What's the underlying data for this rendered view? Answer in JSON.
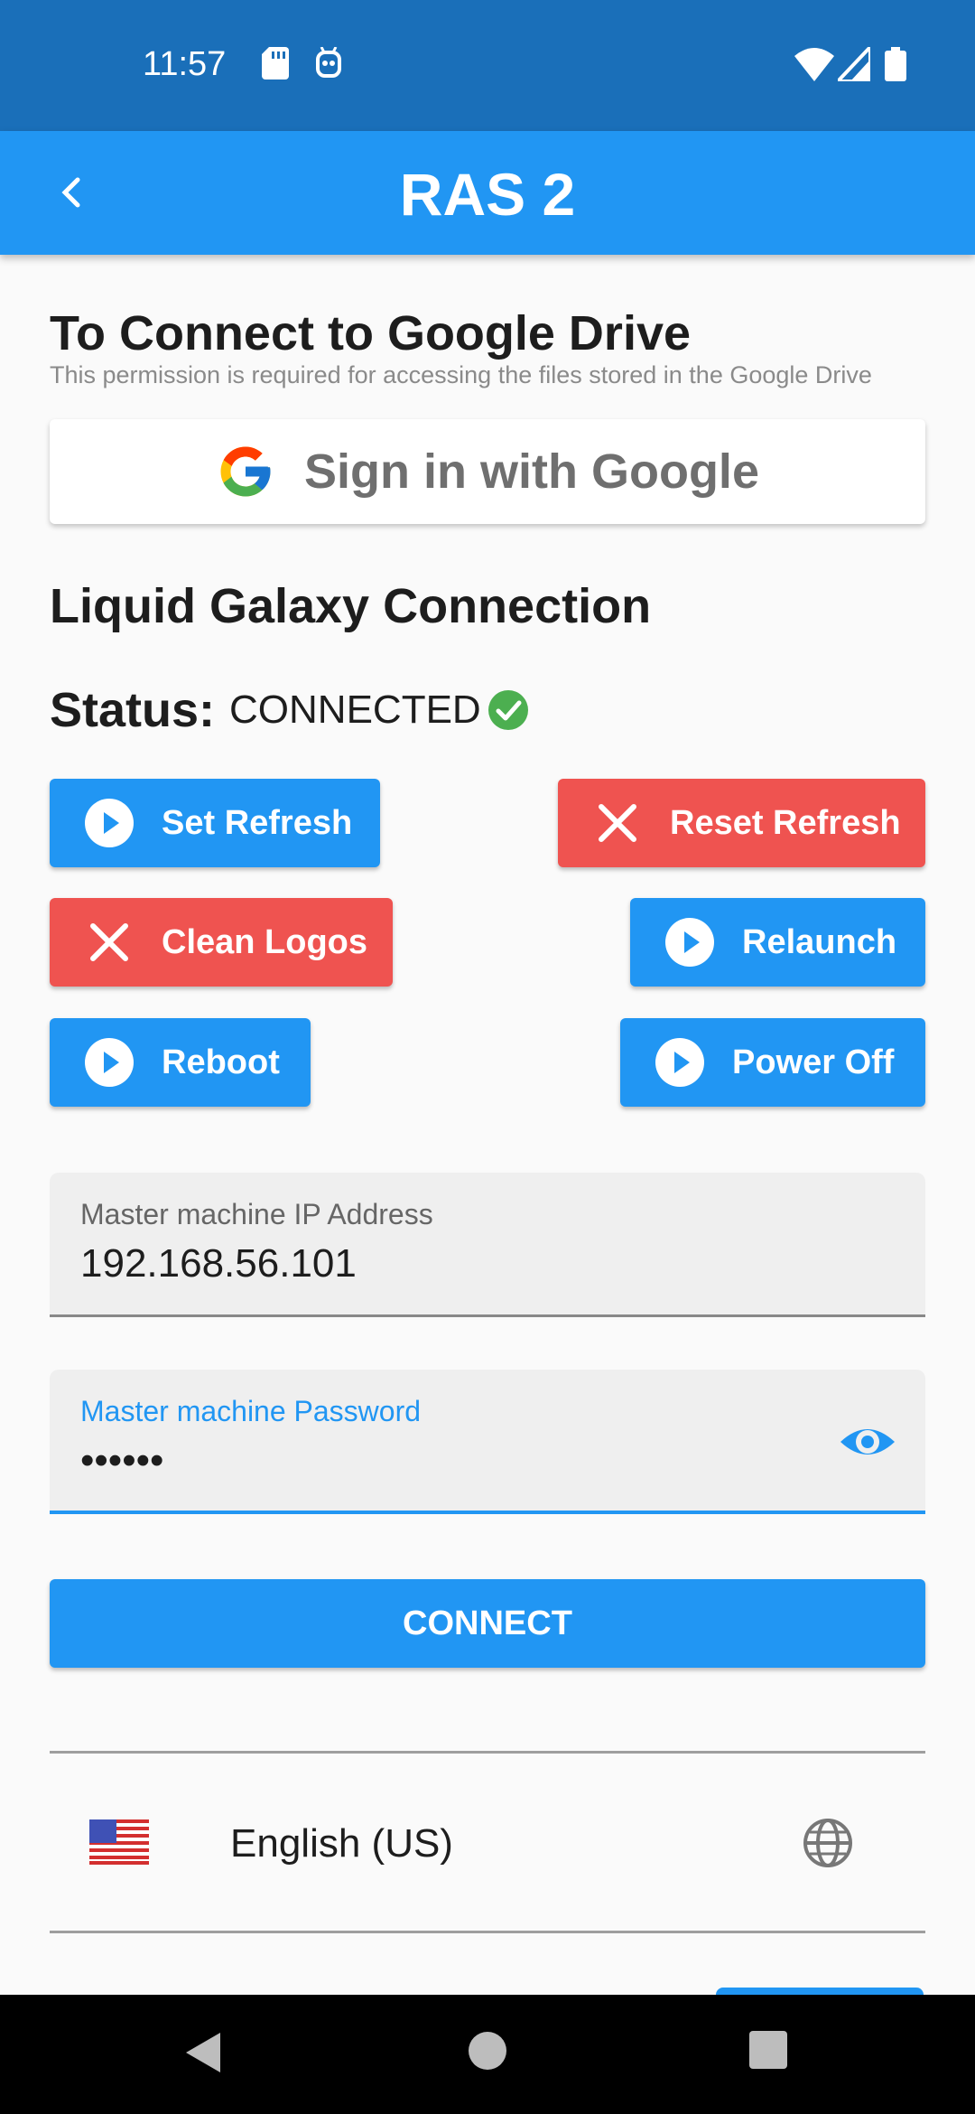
{
  "status_bar": {
    "time": "11:57"
  },
  "app_bar": {
    "title": "RAS 2"
  },
  "drive": {
    "heading": "To Connect to Google Drive",
    "subtext": "This permission is required for accessing the files stored in the Google Drive",
    "sign_in_label": "Sign in with Google"
  },
  "lg": {
    "heading": "Liquid Galaxy Connection",
    "status_label": "Status:",
    "status_value": "CONNECTED",
    "buttons": {
      "set_refresh": "Set Refresh",
      "reset_refresh": "Reset Refresh",
      "clean_logos": "Clean Logos",
      "relaunch": "Relaunch",
      "reboot": "Reboot",
      "power_off": "Power Off"
    }
  },
  "form": {
    "ip_label": "Master machine IP Address",
    "ip_value": "192.168.56.101",
    "password_label": "Master machine Password",
    "password_value": "••••••",
    "connect_label": "CONNECT"
  },
  "language": {
    "label": "English (US)",
    "icons": [
      "us-flag-icon",
      "globe-icon"
    ]
  },
  "colors": {
    "primary": "#2196f3",
    "status_bar": "#1a6fb9",
    "danger": "#ef5350",
    "success": "#4caf50"
  }
}
